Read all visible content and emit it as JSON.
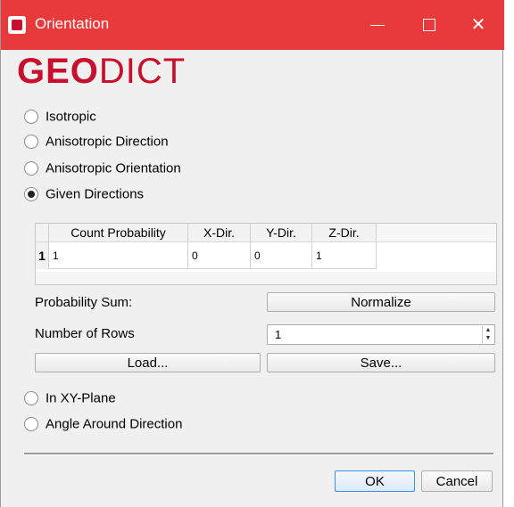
{
  "window": {
    "title": "Orientation"
  },
  "logo": {
    "part1": "GEO",
    "part2": "DICT"
  },
  "options": {
    "isotropic": "Isotropic",
    "anisotropic_direction": "Anisotropic Direction",
    "anisotropic_orientation": "Anisotropic Orientation",
    "given_directions": "Given Directions",
    "in_xy_plane": "In XY-Plane",
    "angle_around_direction": "Angle Around Direction",
    "selected": "Given Directions"
  },
  "table": {
    "columns": [
      "Count Probability",
      "X-Dir.",
      "Y-Dir.",
      "Z-Dir."
    ],
    "rows": [
      {
        "index": "1",
        "count_probability": "1",
        "x_dir": "0",
        "y_dir": "0",
        "z_dir": "1"
      }
    ]
  },
  "controls": {
    "probability_sum_label": "Probability Sum:",
    "normalize_label": "Normalize",
    "number_of_rows_label": "Number of Rows",
    "number_of_rows_value": "1",
    "load_label": "Load...",
    "save_label": "Save..."
  },
  "footer": {
    "ok_label": "OK",
    "cancel_label": "Cancel"
  },
  "colors": {
    "titlebar": "#e83a3a",
    "logo": "#c8102e",
    "ok_border": "#3a8ee6"
  }
}
